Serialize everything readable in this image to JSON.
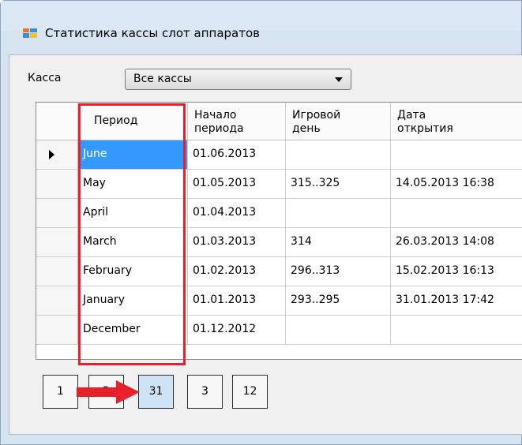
{
  "window": {
    "title": "Статистика кассы слот аппаратов"
  },
  "filter": {
    "label": "Касса",
    "selected": "Все кассы"
  },
  "grid": {
    "columns": [
      "Период",
      "Начало периода",
      "Игровой день",
      "Дата открытия"
    ],
    "column_lines": [
      [
        "Период"
      ],
      [
        "Начало",
        "периода"
      ],
      [
        "Игровой",
        "день"
      ],
      [
        "Дата",
        "открытия"
      ]
    ],
    "rows": [
      [
        "June",
        "01.06.2013",
        "",
        ""
      ],
      [
        "May",
        "01.05.2013",
        "315..325",
        "14.05.2013 16:38"
      ],
      [
        "April",
        "01.04.2013",
        "",
        ""
      ],
      [
        "March",
        "01.03.2013",
        "314",
        "26.03.2013 14:08"
      ],
      [
        "February",
        "01.02.2013",
        "296..313",
        "15.02.2013 16:13"
      ],
      [
        "January",
        "01.01.2013",
        "293..295",
        "31.01.2013 17:42"
      ],
      [
        "December",
        "01.12.2012",
        "",
        ""
      ]
    ],
    "selected_row": 0
  },
  "pager": {
    "buttons": [
      "1",
      "2",
      "31",
      "3",
      "12"
    ],
    "active": "31"
  },
  "colors": {
    "highlight": "#e8202a",
    "selection": "#3399ff",
    "arrow": "#e8202a"
  }
}
